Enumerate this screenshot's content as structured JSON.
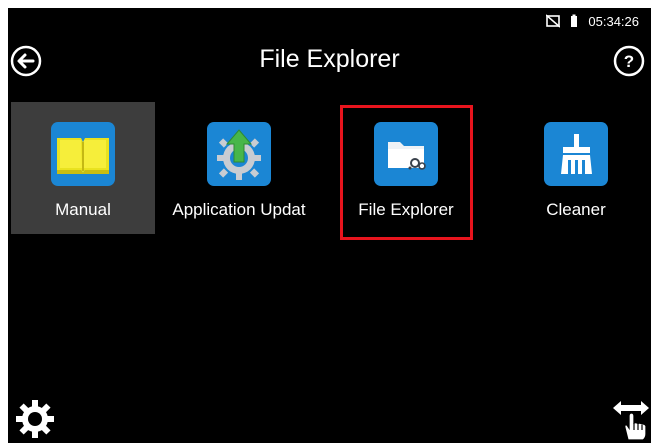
{
  "status": {
    "time": "05:34:26"
  },
  "header": {
    "title": "File Explorer"
  },
  "apps": [
    {
      "label": "Manual"
    },
    {
      "label": "Application Updat"
    },
    {
      "label": "File Explorer"
    },
    {
      "label": "Cleaner"
    }
  ],
  "colors": {
    "background": "#000000",
    "accent_blue": "#1b86d4",
    "highlight_red": "#e8141d",
    "selected_tile": "#3d3d3d"
  },
  "icons": {
    "back": "back-arrow-circle-icon",
    "help": "help-question-icon",
    "settings": "gear-icon",
    "swap": "swap-hand-icon",
    "manual": "open-book-icon",
    "application_update": "update-gear-icon",
    "file_explorer": "folder-gear-icon",
    "cleaner": "broom-icon"
  }
}
